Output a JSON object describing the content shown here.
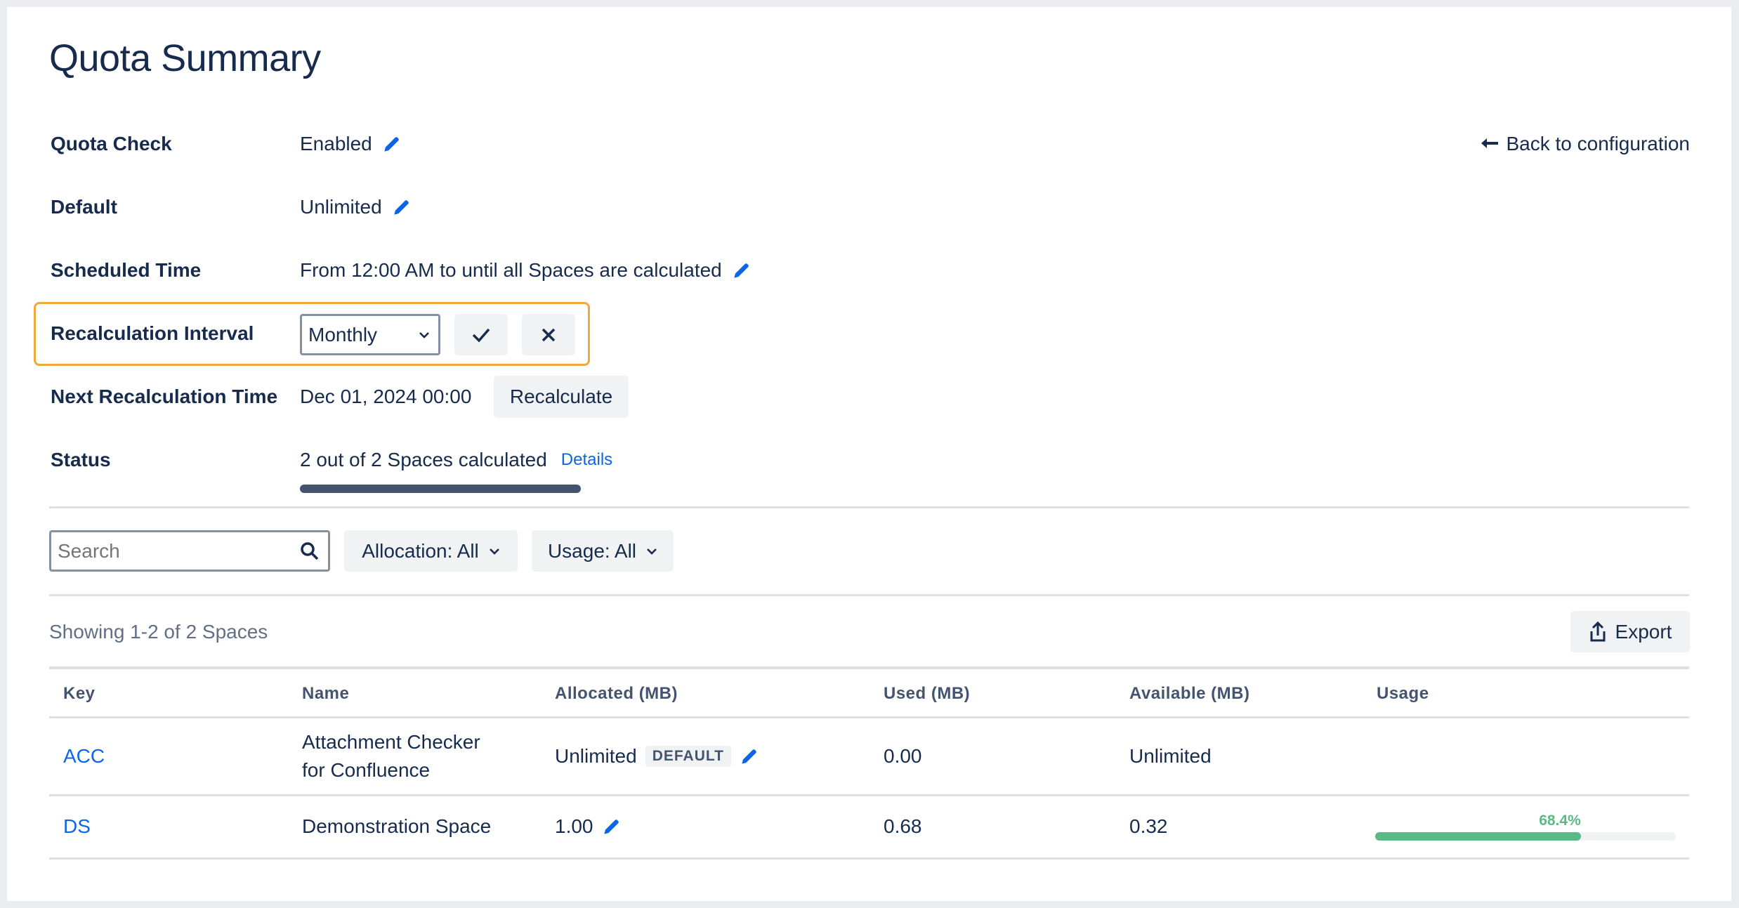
{
  "title": "Quota Summary",
  "back_link": "Back to configuration",
  "fields": {
    "quota_check": {
      "label": "Quota Check",
      "value": "Enabled"
    },
    "default": {
      "label": "Default",
      "value": "Unlimited"
    },
    "scheduled_time": {
      "label": "Scheduled Time",
      "value": "From 12:00 AM to until all Spaces are calculated"
    },
    "recalc_interval": {
      "label": "Recalculation Interval",
      "value": "Monthly"
    },
    "next_recalc": {
      "label": "Next Recalculation Time",
      "value": "Dec 01, 2024 00:00",
      "button": "Recalculate"
    },
    "status": {
      "label": "Status",
      "value": "2 out of 2 Spaces calculated",
      "details": "Details",
      "progress_percent": 100
    }
  },
  "filters": {
    "search_placeholder": "Search",
    "allocation": "Allocation: All",
    "usage": "Usage: All"
  },
  "summary": "Showing 1-2 of 2 Spaces",
  "export": "Export",
  "table": {
    "headers": [
      "Key",
      "Name",
      "Allocated (MB)",
      "Used (MB)",
      "Available (MB)",
      "Usage"
    ],
    "rows": [
      {
        "key": "ACC",
        "name_line1": "Attachment Checker",
        "name_line2": "for Confluence",
        "allocated": "Unlimited",
        "badge": "DEFAULT",
        "used": "0.00",
        "available": "Unlimited"
      },
      {
        "key": "DS",
        "name": "Demonstration Space",
        "allocated": "1.00",
        "used": "0.68",
        "available": "0.32",
        "usage_label": "68.4%",
        "usage_percent": 68.4
      }
    ]
  },
  "colors": {
    "accent": "#0c66e4",
    "highlight": "#f0a93d",
    "usage": "#5bb985",
    "status_bar": "#44546f"
  }
}
